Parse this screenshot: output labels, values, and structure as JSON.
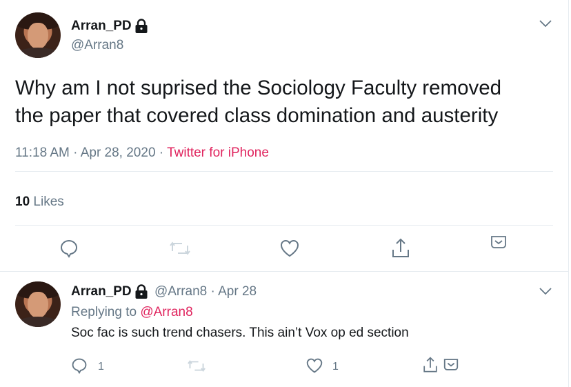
{
  "main_tweet": {
    "author_name": "Arran_PD",
    "author_handle": "@Arran8",
    "text_line1": "Why am I not suprised the Sociology Faculty removed",
    "text_line2": "the paper that covered class domination and austerity",
    "timestamp": "11:18 AM · Apr 28, 2020",
    "separator": " · ",
    "source": "Twitter for iPhone",
    "likes_count": "10",
    "likes_label": "Likes"
  },
  "reply_tweet": {
    "author_name": "Arran_PD",
    "author_handle": "@Arran8",
    "date": "· Apr 28",
    "replying_to_label": "Replying to",
    "replying_to_handle": "@Arran8",
    "text": "Soc fac is such trend chasers. This ain’t Vox op ed section",
    "reply_count": "1",
    "like_count": "1"
  },
  "icons": {
    "lock": "lock-icon",
    "chevron": "chevron-down-icon",
    "reply": "reply-icon",
    "retweet": "retweet-icon",
    "like": "heart-icon",
    "share": "share-icon",
    "bookmark": "bookmark-icon"
  },
  "colors": {
    "text": "#14171a",
    "secondary": "#657786",
    "accent": "#e0245e",
    "icon": "#657786",
    "retweet_disabled": "#ccd6dd",
    "divider": "#e6ecf0"
  }
}
